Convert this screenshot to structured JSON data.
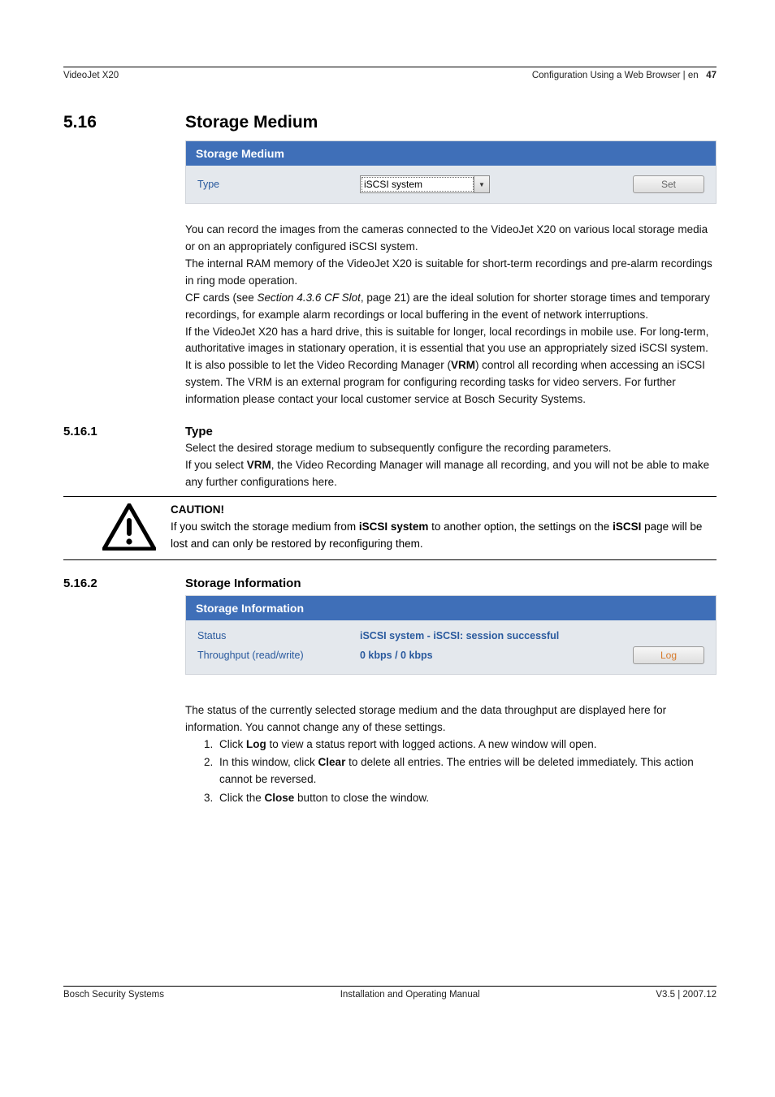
{
  "header": {
    "left": "VideoJet X20",
    "right_label": "Configuration Using a Web Browser | en",
    "page_number": "47"
  },
  "sec_516": {
    "number": "5.16",
    "title": "Storage Medium"
  },
  "panel_medium": {
    "header": "Storage Medium",
    "type_label": "Type",
    "type_value": "iSCSI system",
    "set_button": "Set"
  },
  "body_516": {
    "p1": "You can record the images from the cameras connected to the VideoJet X20 on various local storage media or on an appropriately configured iSCSI system.",
    "p2": "The internal RAM memory of the VideoJet X20 is suitable for short-term recordings and pre-alarm recordings in ring mode operation.",
    "p3a": "CF cards (see ",
    "p3_ref": "Section 4.3.6 CF Slot",
    "p3b": ", page 21) are the ideal solution for shorter storage times and temporary recordings, for example alarm recordings or local buffering in the event of network interruptions.",
    "p4": "If the VideoJet X20 has a hard drive, this is suitable for longer, local recordings in mobile use. For long-term, authoritative images in stationary operation, it is essential that you use an appropriately sized iSCSI system.",
    "p5a": "It is also possible to let the Video Recording Manager (",
    "p5_vrm": "VRM",
    "p5b": ") control all recording when accessing an iSCSI system. The VRM is an external program for configuring recording tasks for video servers. For further information please contact your local customer service at Bosch Security Systems."
  },
  "sec_5161": {
    "number": "5.16.1",
    "title": "Type",
    "p1": "Select the desired storage medium to subsequently configure the recording parameters.",
    "p2a": "If you select ",
    "p2_vrm": "VRM",
    "p2b": ", the Video Recording Manager will manage all recording, and you will not be able to make any further configurations here."
  },
  "caution": {
    "heading": "CAUTION!",
    "t1": "If you switch the storage medium from ",
    "b1": "iSCSI system",
    "t2": " to another option, the settings on the ",
    "b2": "iSCSI",
    "t3": " page will be lost and can only be restored by reconfiguring them."
  },
  "sec_5162": {
    "number": "5.16.2",
    "title": "Storage Information"
  },
  "panel_info": {
    "header": "Storage Information",
    "status_label": "Status",
    "status_value": "iSCSI system - iSCSI: session successful",
    "throughput_label": "Throughput (read/write)",
    "throughput_value": "0 kbps / 0 kbps",
    "log_button": "Log"
  },
  "body_5162": {
    "p1": "The status of the currently selected storage medium and the data throughput are displayed here for information. You cannot change any of these settings.",
    "s1a": "Click ",
    "s1b": "Log",
    "s1c": " to view a status report with logged actions. A new window will open.",
    "s2a": "In this window, click ",
    "s2b": "Clear",
    "s2c": " to delete all entries. The entries will be deleted immediately. This action cannot be reversed.",
    "s3a": "Click the ",
    "s3b": "Close",
    "s3c": " button to close the window."
  },
  "footer": {
    "left": "Bosch Security Systems",
    "center": "Installation and Operating Manual",
    "right": "V3.5 | 2007.12"
  }
}
